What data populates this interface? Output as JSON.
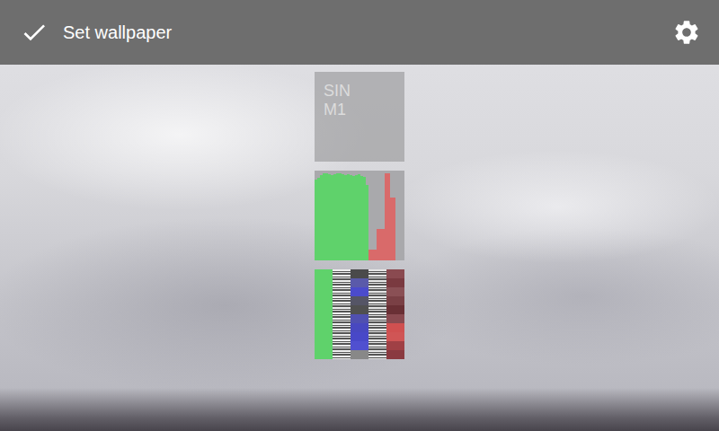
{
  "app_bar": {
    "title": "Set wallpaper"
  },
  "previews": [
    {
      "kind": "text",
      "lines": [
        "SIN",
        "M1"
      ]
    },
    {
      "kind": "bars",
      "series": [
        {
          "color": "#5fd26b",
          "values": [
            90,
            92,
            95,
            97,
            97,
            96,
            95,
            96,
            97,
            97,
            96,
            95,
            96,
            95,
            94,
            95,
            96,
            94,
            93,
            84
          ]
        },
        {
          "color": "#d96a6a",
          "values": [
            12,
            12,
            12,
            35,
            35,
            35,
            97,
            97,
            70,
            70
          ]
        }
      ]
    },
    {
      "kind": "grid",
      "columns": [
        {
          "kind": "solid",
          "colors": [
            "#5fd26b"
          ]
        },
        {
          "kind": "stripes",
          "colors": [
            "#eeeeee",
            "#555555"
          ]
        },
        {
          "kind": "cells",
          "colors": [
            "#4a4a4a",
            "#5a5aaa",
            "#4b4bcc",
            "#555566",
            "#505050",
            "#5050b0",
            "#4848c0",
            "#4848c8",
            "#5050d0",
            "#888888"
          ]
        },
        {
          "kind": "stripes",
          "colors": [
            "#e6e6e6",
            "#555555"
          ]
        },
        {
          "kind": "cells",
          "colors": [
            "#8a4a50",
            "#7a3a40",
            "#8a5055",
            "#7a4045",
            "#6a3035",
            "#8a4a50",
            "#d05050",
            "#d05555",
            "#a04045",
            "#8a3a40"
          ]
        }
      ]
    }
  ]
}
